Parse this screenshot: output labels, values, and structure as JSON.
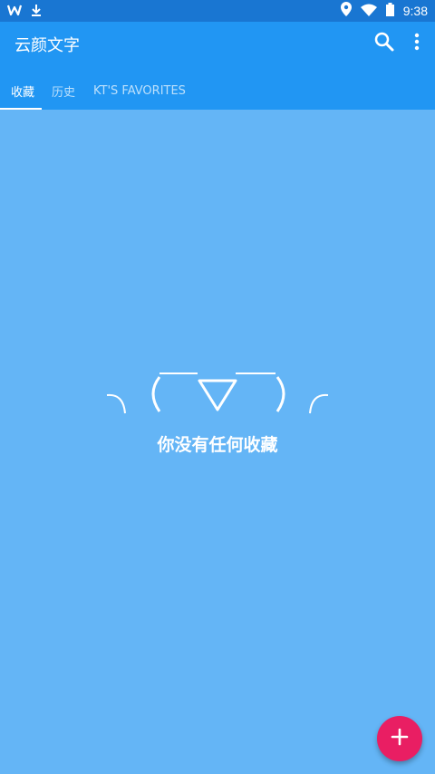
{
  "status_bar": {
    "time": "9:38",
    "icons_left": [
      "app-w-icon",
      "download-icon"
    ],
    "icons_right": [
      "location-icon",
      "wifi-icon",
      "battery-icon"
    ]
  },
  "app_bar": {
    "title": "云颜文字",
    "actions": [
      "search-icon",
      "more-vert-icon"
    ]
  },
  "tabs": [
    {
      "label": "收藏",
      "active": true
    },
    {
      "label": "历史",
      "active": false
    },
    {
      "label": "KT'S FAVORITES",
      "active": false
    }
  ],
  "empty_state": {
    "message": "你没有任何收藏"
  },
  "fab": {
    "icon": "plus-icon"
  },
  "colors": {
    "status_bar": "#1976d2",
    "app_bar": "#2196f3",
    "background": "#64b5f6",
    "fab": "#e91e63"
  }
}
